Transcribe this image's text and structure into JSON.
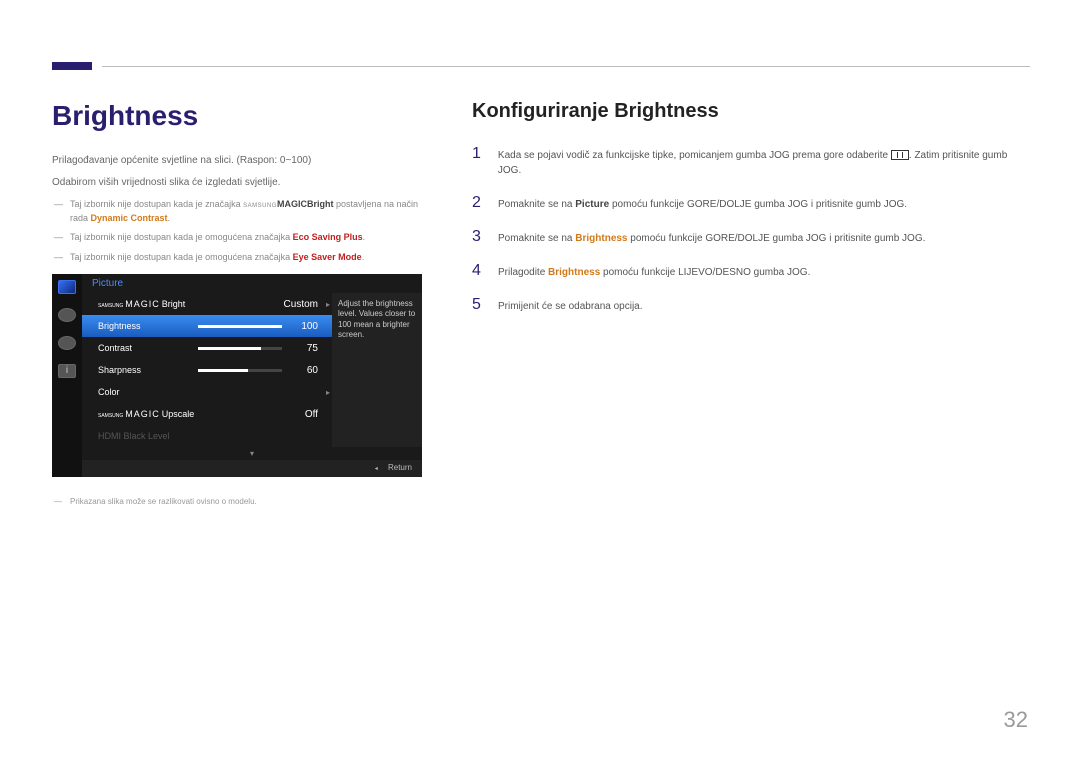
{
  "page_number": "32",
  "heading_left": "Brightness",
  "heading_right": "Konfiguriranje Brightness",
  "desc1": "Prilagođavanje općenite svjetline na slici. (Raspon: 0~100)",
  "desc2": "Odabirom viših vrijednosti slika će izgledati svjetlije.",
  "notes": [
    {
      "pre": "Taj izbornik nije dostupan kada je značajka ",
      "magic_sup": "SAMSUNG",
      "magic": "MAGIC",
      "magic_suf": "Bright",
      "mid": " postavljena na način rada ",
      "hl": "Dynamic Contrast",
      "hl_class": "highlight-brown",
      "suf": "."
    },
    {
      "pre": "Taj izbornik nije dostupan kada je omogućena značajka ",
      "hl": "Eco Saving Plus",
      "hl_class": "highlight-red",
      "suf": "."
    },
    {
      "pre": "Taj izbornik nije dostupan kada je omogućena značajka ",
      "hl": "Eye Saver Mode",
      "hl_class": "highlight-red",
      "suf": "."
    }
  ],
  "footnote": "Prikazana slika može se razlikovati ovisno o modelu.",
  "osd": {
    "title": "Picture",
    "tooltip": "Adjust the brightness level. Values closer to 100 mean a brighter screen.",
    "rows": [
      {
        "label_sup": "SAMSUNG",
        "label": "MAGIC",
        "label_suf": "Bright",
        "value": "Custom",
        "slider": null,
        "active": false,
        "arrow": true
      },
      {
        "label": "Brightness",
        "value": "100",
        "slider": 100,
        "active": true
      },
      {
        "label": "Contrast",
        "value": "75",
        "slider": 75
      },
      {
        "label": "Sharpness",
        "value": "60",
        "slider": 60
      },
      {
        "label": "Color",
        "value": "",
        "slider": null,
        "arrow": true
      },
      {
        "label_sup": "SAMSUNG",
        "label": "MAGIC",
        "label_suf": "Upscale",
        "value": "Off",
        "slider": null
      },
      {
        "label": "HDMI Black Level",
        "value": "",
        "slider": null,
        "dim": true
      }
    ],
    "footer": "Return"
  },
  "steps": [
    {
      "n": "1",
      "pre": "Kada se pojavi vodič za funkcijske tipke, pomicanjem gumba JOG prema gore odaberite ",
      "icon": true,
      "suf": ". Zatim pritisnite gumb JOG."
    },
    {
      "n": "2",
      "pre": "Pomaknite se na ",
      "hl": "Picture",
      "suf": " pomoću funkcije GORE/DOLJE gumba JOG i pritisnite gumb JOG."
    },
    {
      "n": "3",
      "pre": "Pomaknite se na ",
      "hl": "Brightness",
      "hl_class": "highlight-brown",
      "suf": " pomoću funkcije GORE/DOLJE gumba JOG i pritisnite gumb JOG."
    },
    {
      "n": "4",
      "pre": "Prilagodite ",
      "hl": "Brightness",
      "hl_class": "highlight-brown",
      "suf": " pomoću funkcije LIJEVO/DESNO gumba JOG."
    },
    {
      "n": "5",
      "pre": "Primijenit će se odabrana opcija.",
      "suf": ""
    }
  ]
}
